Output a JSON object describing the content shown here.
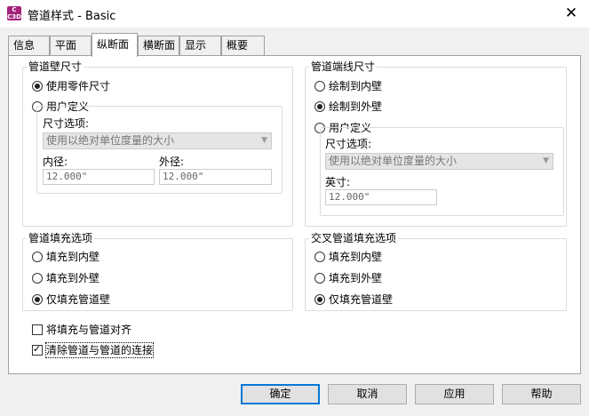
{
  "window": {
    "title": "管道样式 - Basic",
    "app_icon_text": "C\nC3D",
    "close_glyph": "✕"
  },
  "tabs": [
    "信息",
    "平面",
    "纵断面",
    "横断面",
    "显示",
    "概要"
  ],
  "wall_size": {
    "title": "管道壁尺寸",
    "opt_use_part": "使用零件尺寸",
    "opt_user_defined": "用户定义",
    "size_option_label": "尺寸选项:",
    "size_option_value": "使用以绝对单位度量的大小",
    "inner_label": "内径:",
    "inner_value": "12.000\"",
    "outer_label": "外径:",
    "outer_value": "12.000\""
  },
  "end_line": {
    "title": "管道端线尺寸",
    "opt_inner": "绘制到内壁",
    "opt_outer": "绘制到外壁",
    "opt_user_defined": "用户定义",
    "size_option_label": "尺寸选项:",
    "size_option_value": "使用以绝对单位度量的大小",
    "inch_label": "英寸:",
    "inch_value": "12.000\""
  },
  "fill": {
    "title": "管道填充选项",
    "opt_inner": "填充到内壁",
    "opt_outer": "填充到外壁",
    "opt_wall": "仅填充管道壁"
  },
  "cross_fill": {
    "title": "交叉管道填充选项",
    "opt_inner": "填充到内壁",
    "opt_outer": "填充到外壁",
    "opt_wall": "仅填充管道壁"
  },
  "checkboxes": {
    "align_fill": "将填充与管道对齐",
    "clear_connection": "清除管道与管道的连接"
  },
  "buttons": {
    "ok": "确定",
    "cancel": "取消",
    "apply": "应用",
    "help": "帮助"
  }
}
